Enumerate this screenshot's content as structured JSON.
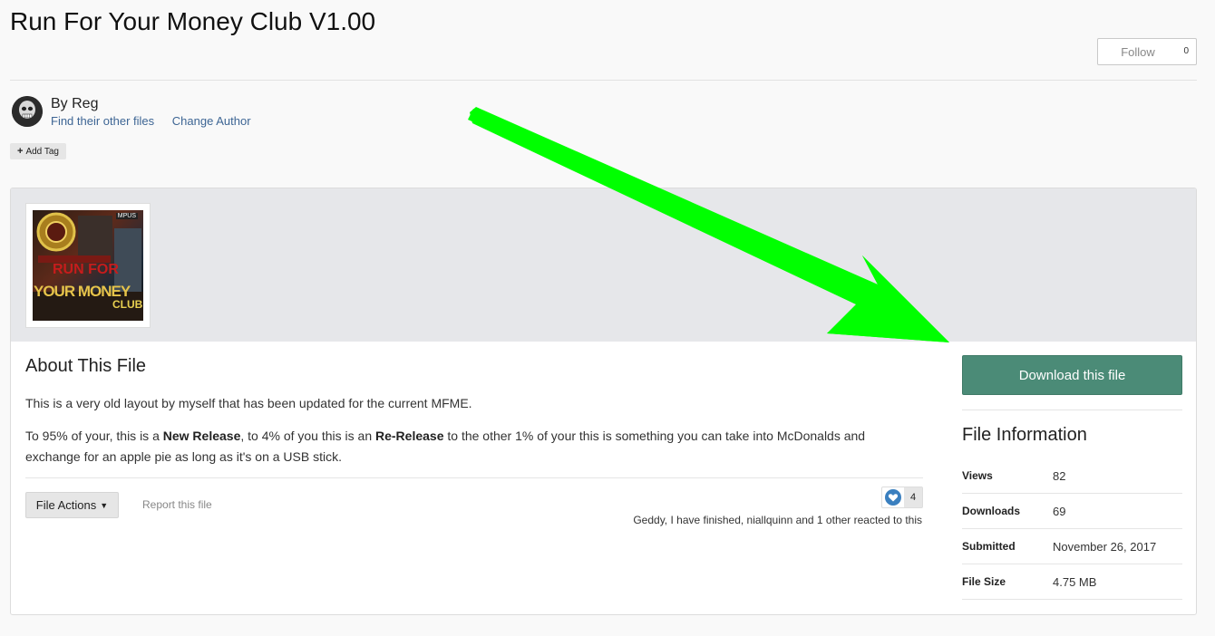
{
  "title": "Run For Your Money Club V1.00",
  "follow": {
    "label": "Follow",
    "count": "0"
  },
  "author": {
    "byline": "By Reg",
    "find_files": "Find their other files",
    "change_author": "Change Author"
  },
  "tags": {
    "add_tag": "Add Tag"
  },
  "thumbnail": {
    "badge": "MPUS",
    "line1": "RUN FOR",
    "line2": "YOUR MONEY",
    "line3": "CLUB"
  },
  "about": {
    "title": "About This File",
    "para1": "This is a very old layout by myself that has been updated for the current MFME.",
    "para2": {
      "t1": "To 95% of your, this is a ",
      "b1": "New Release",
      "t2": ", to 4% of you this is an ",
      "b2": "Re-Release",
      "t3": " to the other 1% of your this is something you can take into McDonalds and exchange for an apple pie as long as it's on a USB stick."
    }
  },
  "actions": {
    "file_actions": "File Actions",
    "report": "Report this file"
  },
  "reactions": {
    "count": "4",
    "summary": "Geddy, I have finished, niallquinn and 1 other reacted to this"
  },
  "download": {
    "label": "Download this file"
  },
  "file_info": {
    "title": "File Information",
    "rows": [
      {
        "key": "Views",
        "value": "82"
      },
      {
        "key": "Downloads",
        "value": "69"
      },
      {
        "key": "Submitted",
        "value": "November 26, 2017"
      },
      {
        "key": "File Size",
        "value": "4.75 MB"
      }
    ]
  },
  "colors": {
    "download_button": "#4b8b77",
    "link": "#3d6594",
    "annotation_arrow": "#00ff00",
    "header_band": "#e6e7ea"
  },
  "icons": [
    "plus-icon",
    "caret-down-icon",
    "heart-icon",
    "avatar-image",
    "annotation-arrow"
  ]
}
